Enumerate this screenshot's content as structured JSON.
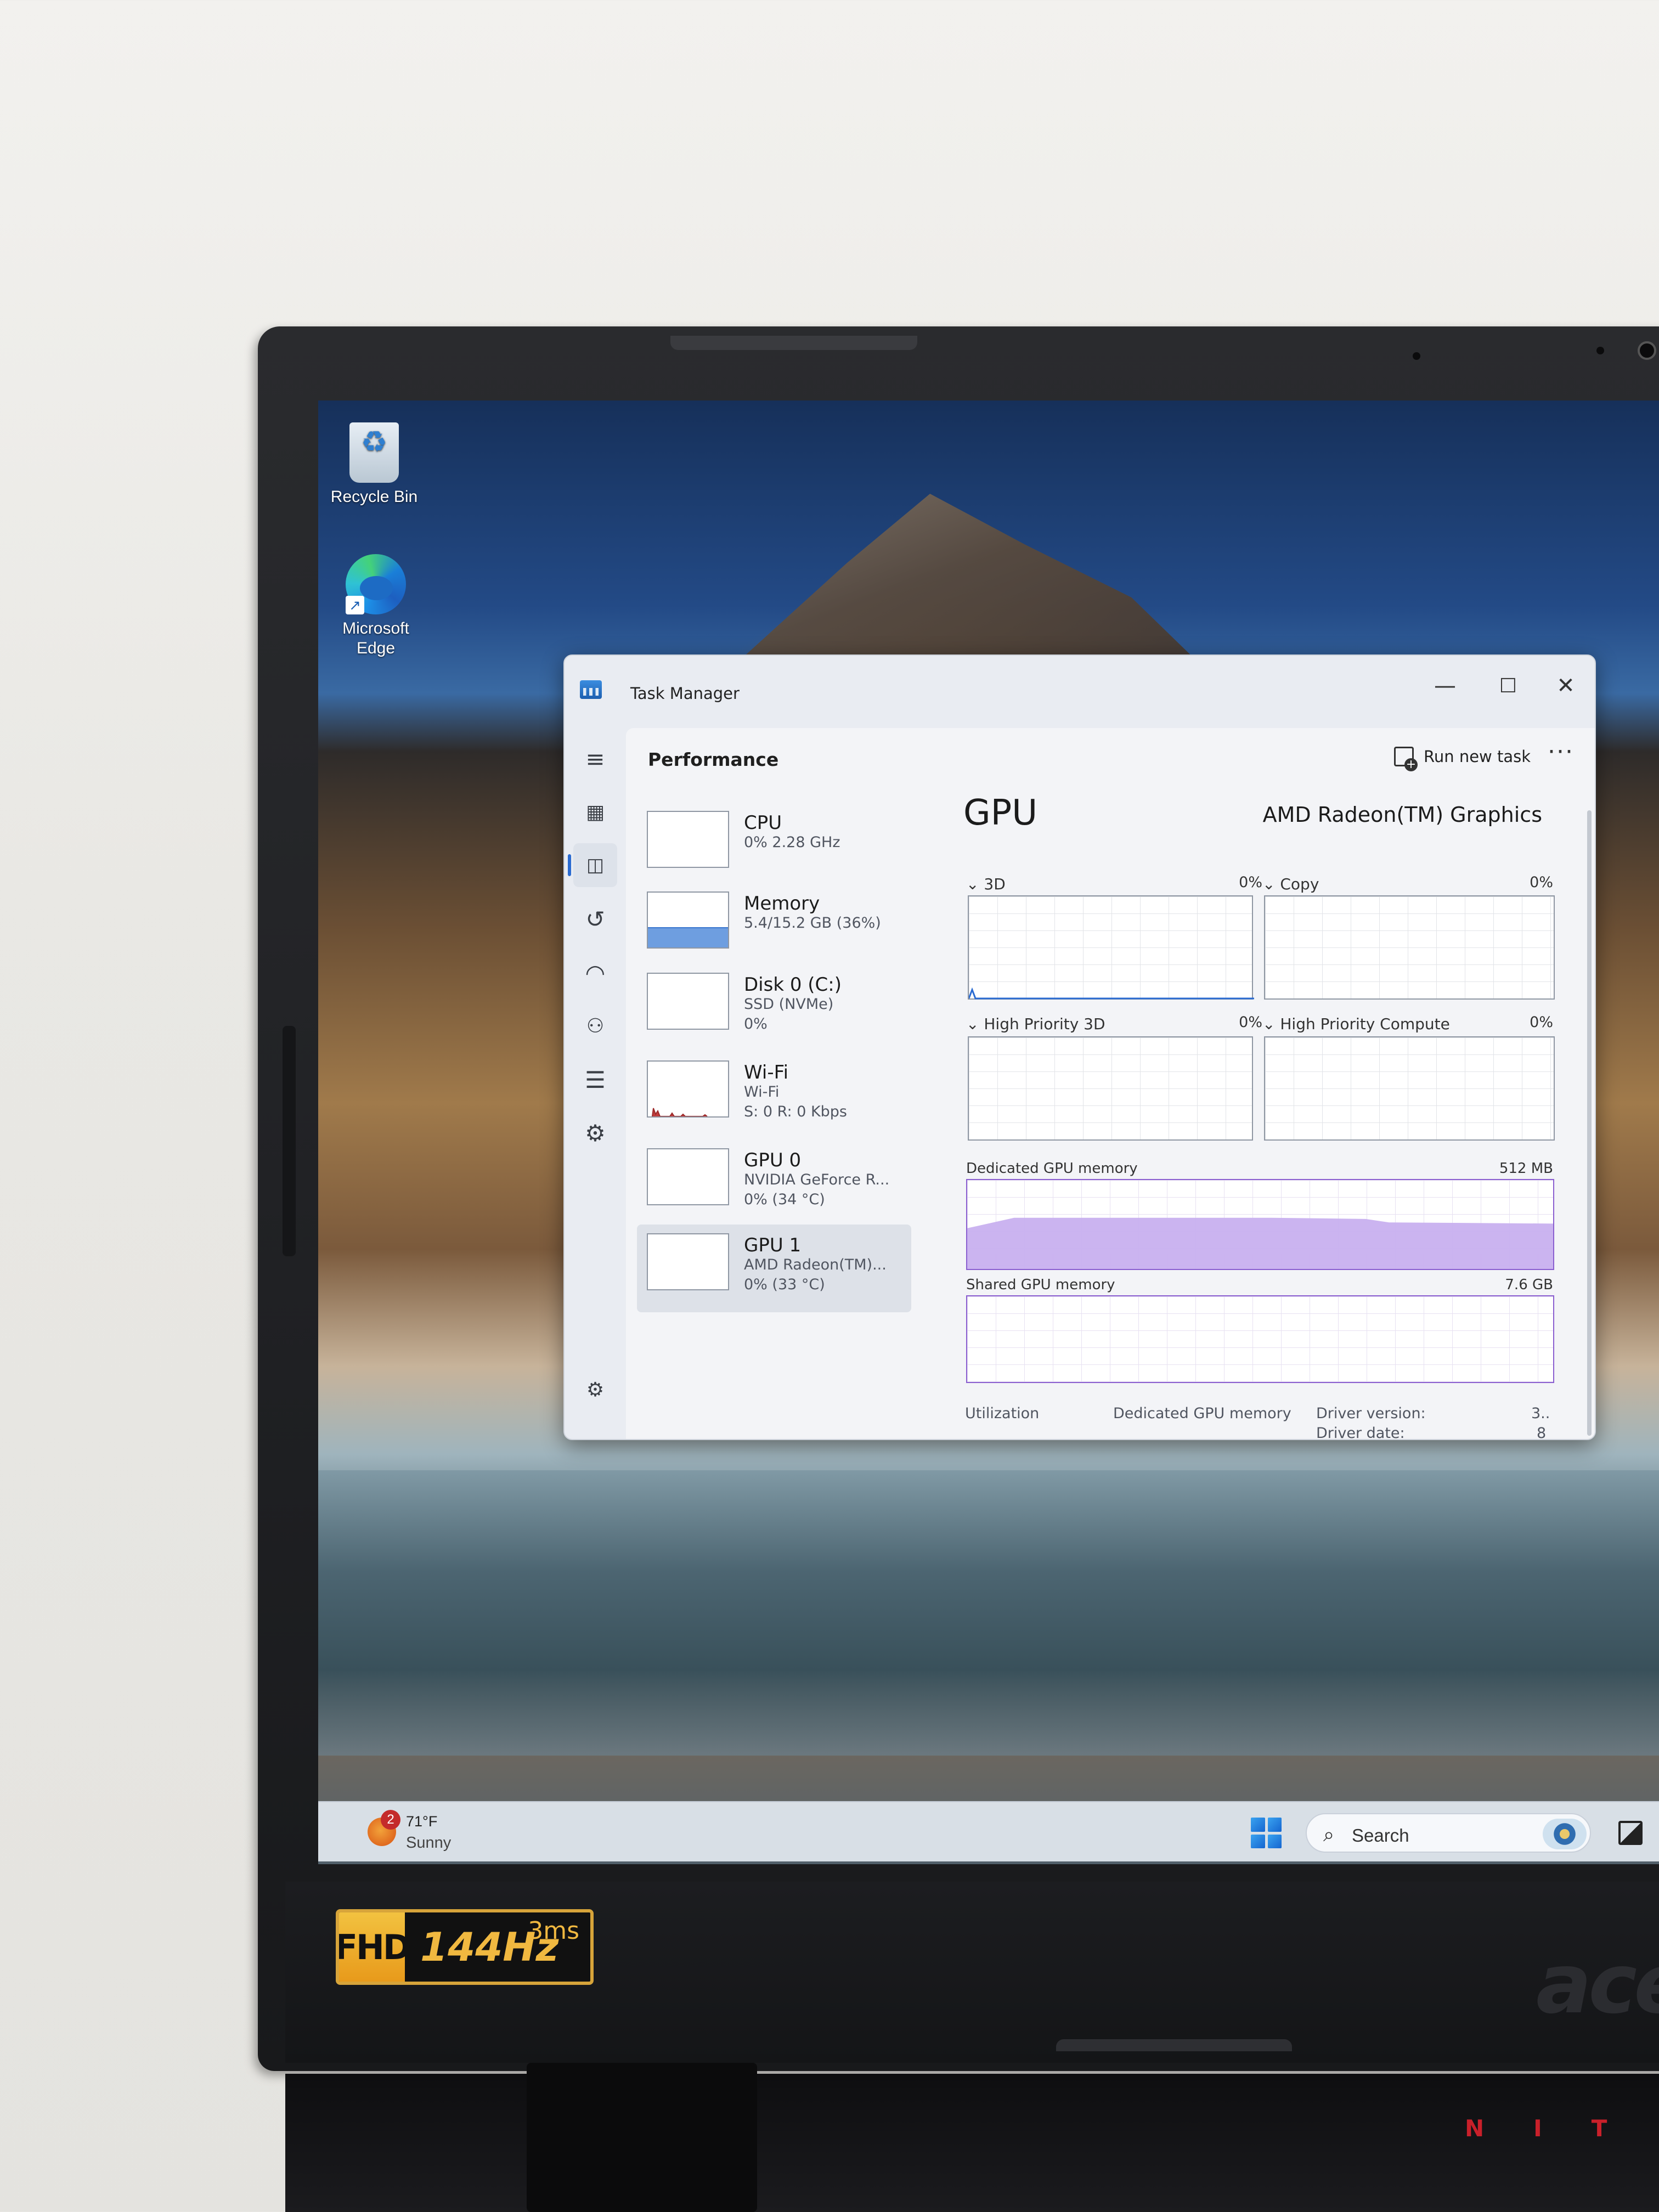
{
  "desktop": {
    "icons": [
      {
        "label": "Recycle Bin"
      },
      {
        "label": "Microsoft Edge"
      }
    ]
  },
  "task_manager": {
    "window_title": "Task Manager",
    "section_title": "Performance",
    "run_new_task_label": "Run new task",
    "more_label": "···",
    "window_controls": {
      "minimize": "—",
      "maximize": "☐",
      "close": "✕"
    },
    "sidebar_icons": [
      "hamburger-icon",
      "processes-icon",
      "performance-icon",
      "app-history-icon",
      "startup-apps-icon",
      "users-icon",
      "details-icon",
      "services-icon",
      "settings-icon"
    ],
    "devices": [
      {
        "name": "CPU",
        "line1": "0% 2.28 GHz",
        "line2": ""
      },
      {
        "name": "Memory",
        "line1": "5.4/15.2 GB (36%)",
        "line2": "",
        "usage_fraction": 0.36
      },
      {
        "name": "Disk 0 (C:)",
        "line1": "SSD (NVMe)",
        "line2": "0%"
      },
      {
        "name": "Wi-Fi",
        "line1": "Wi-Fi",
        "line2": "S: 0 R: 0 Kbps"
      },
      {
        "name": "GPU 0",
        "line1": "NVIDIA GeForce R...",
        "line2": "0% (34 °C)"
      },
      {
        "name": "GPU 1",
        "line1": "AMD Radeon(TM)...",
        "line2": "0% (33 °C)",
        "selected": true
      }
    ],
    "detail": {
      "title": "GPU",
      "model": "AMD Radeon(TM) Graphics",
      "engines": [
        {
          "name": "3D",
          "percent": "0%"
        },
        {
          "name": "Copy",
          "percent": "0%"
        },
        {
          "name": "High Priority 3D",
          "percent": "0%"
        },
        {
          "name": "High Priority Compute",
          "percent": "0%"
        }
      ],
      "dedicated_memory_label": "Dedicated GPU memory",
      "dedicated_memory_max": "512 MB",
      "shared_memory_label": "Shared GPU memory",
      "shared_memory_max": "7.6 GB",
      "stats": {
        "utilization_label": "Utilization",
        "dedicated_label": "Dedicated GPU memory",
        "driver_version_label": "Driver version:",
        "driver_version_value": "3..",
        "driver_date_label": "Driver date:",
        "driver_date_value": "8"
      }
    }
  },
  "taskbar": {
    "weather_temp": "71°F",
    "weather_condition": "Sunny",
    "weather_badge": "2",
    "search_placeholder": "Search"
  },
  "hardware": {
    "badge_fhd": "FHD",
    "badge_hz": "144Hz",
    "badge_ms": "3ms",
    "brand": "acer",
    "nitro": "NIT"
  }
}
